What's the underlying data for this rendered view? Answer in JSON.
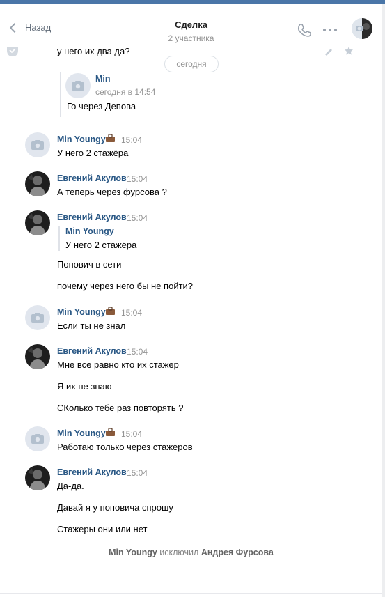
{
  "header": {
    "back_label": "Назад",
    "title": "Сделка",
    "subtitle": "2 участника"
  },
  "icons": {
    "back": "chevron-left-icon",
    "phone": "phone-icon",
    "more": "more-dots-icon",
    "camera": "camera-icon",
    "briefcase": "briefcase-icon",
    "check": "check-circle-icon",
    "pencil": "pencil-icon",
    "star": "star-icon"
  },
  "colors": {
    "accent": "#4a76a8",
    "name": "#2a5885",
    "muted": "#939393"
  },
  "top_cut_text": "у него их два да?",
  "date_divider": "сегодня",
  "forwarded": {
    "name": "Min",
    "time": "сегодня в 14:54",
    "text": "Го через Депова"
  },
  "messages": [
    {
      "author": "Min Youngy",
      "time": "15:04",
      "lines": [
        "У него 2 стажёра"
      ]
    },
    {
      "author": "Евгений Акулов",
      "time": "15:04",
      "lines": [
        "А теперь через фурсова ?"
      ]
    },
    {
      "author": "Евгений Акулов",
      "time": "15:04",
      "quote": {
        "name": "Min Youngy",
        "text": "У него 2 стажёра"
      },
      "lines": [
        "Попович в сети",
        "почему через него бы не пойти?"
      ]
    },
    {
      "author": "Min Youngy",
      "time": "15:04",
      "lines": [
        "Если ты не знал"
      ]
    },
    {
      "author": "Евгений Акулов",
      "time": "15:04",
      "lines": [
        "Мне все равно кто их стажер",
        "Я их не знаю",
        "СКолько тебе раз повторять ?"
      ]
    },
    {
      "author": "Min Youngy",
      "time": "15:04",
      "lines": [
        "Работаю только через стажеров"
      ]
    },
    {
      "author": "Евгений Акулов",
      "time": "15:04",
      "lines": [
        "Да-да.",
        "Давай я у поповича спрошу",
        "Стажеры они или нет"
      ]
    }
  ],
  "service": {
    "actor": "Min Youngy",
    "action": "исключил",
    "target": "Андрея Фурсова"
  }
}
